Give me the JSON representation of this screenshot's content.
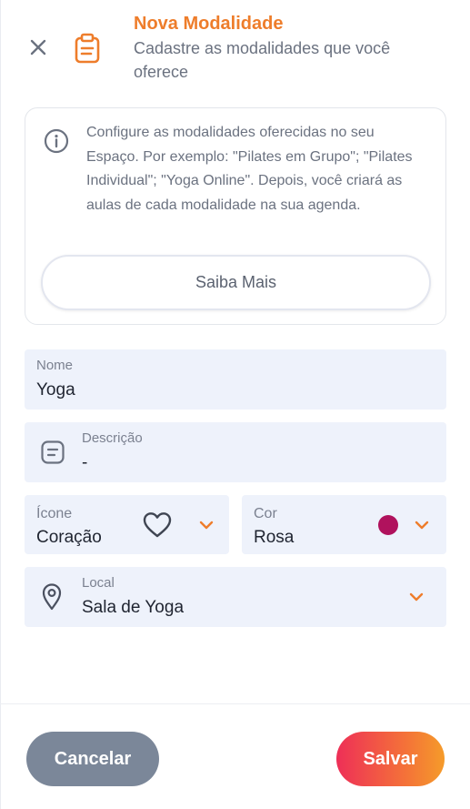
{
  "header": {
    "title": "Nova Modalidade",
    "subtitle": "Cadastre as modalidades que você oferece",
    "close_icon": "close-icon",
    "clipboard_icon": "clipboard-icon"
  },
  "info": {
    "icon": "info-icon",
    "text": "Configure as modalidades oferecidas no seu Espaço. Por exemplo: \"Pilates em Grupo\"; \"Pilates Individual\"; \"Yoga Online\". Depois, você criará as aulas de cada modalidade na sua agenda.",
    "button_label": "Saiba Mais"
  },
  "form": {
    "name": {
      "label": "Nome",
      "value": "Yoga"
    },
    "description": {
      "label": "Descrição",
      "value": "-",
      "icon": "description-icon"
    },
    "icon_select": {
      "label": "Ícone",
      "value": "Coração",
      "icon": "heart-icon"
    },
    "color_select": {
      "label": "Cor",
      "value": "Rosa",
      "swatch_color": "#b0125d"
    },
    "location": {
      "label": "Local",
      "value": "Sala de Yoga",
      "icon": "location-pin-icon"
    }
  },
  "footer": {
    "cancel_label": "Cancelar",
    "save_label": "Salvar"
  },
  "colors": {
    "accent": "#ee7d2b",
    "field_bg": "#eef2fb",
    "cancel_bg": "#7b8799",
    "save_gradient_start": "#ee2f57",
    "save_gradient_end": "#f59b2a"
  }
}
